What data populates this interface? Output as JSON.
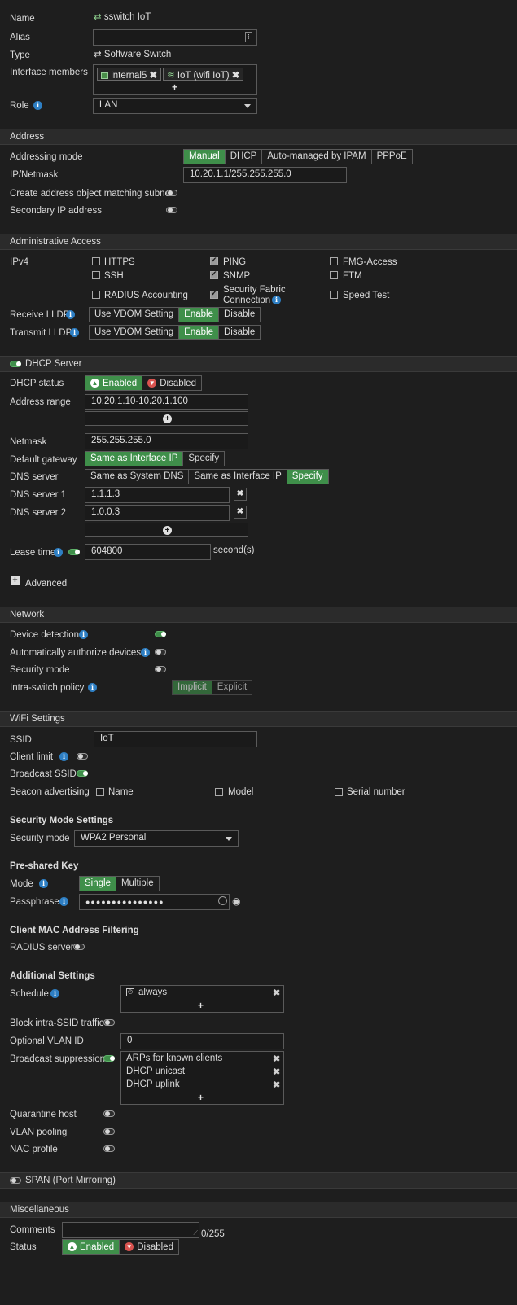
{
  "general": {
    "name_label": "Name",
    "name_value": "sswitch IoT",
    "alias_label": "Alias",
    "type_label": "Type",
    "type_value": "Software Switch",
    "members_label": "Interface members",
    "members": [
      "internal5",
      "IoT (wifi IoT)"
    ],
    "role_label": "Role",
    "role_value": "LAN"
  },
  "address": {
    "title": "Address",
    "mode_label": "Addressing mode",
    "modes": [
      "Manual",
      "DHCP",
      "Auto-managed by IPAM",
      "PPPoE"
    ],
    "ip_label": "IP/Netmask",
    "ip_value": "10.20.1.1/255.255.255.0",
    "create_obj_label": "Create address object matching subnet",
    "secondary_label": "Secondary IP address"
  },
  "admin": {
    "title": "Administrative Access",
    "ipv4_label": "IPv4",
    "opts": [
      "HTTPS",
      "PING",
      "FMG-Access",
      "SSH",
      "SNMP",
      "FTM",
      "RADIUS Accounting",
      "Security Fabric",
      "Connection",
      "Speed Test"
    ],
    "receive_label": "Receive LLDP",
    "transmit_label": "Transmit LLDP",
    "lldp": [
      "Use VDOM Setting",
      "Enable",
      "Disable"
    ]
  },
  "dhcp": {
    "title": "DHCP Server",
    "status_label": "DHCP status",
    "enabled": "Enabled",
    "disabled": "Disabled",
    "range_label": "Address range",
    "range_value": "10.20.1.10-10.20.1.100",
    "netmask_label": "Netmask",
    "netmask_value": "255.255.255.0",
    "gateway_label": "Default gateway",
    "gateway_opts": [
      "Same as Interface IP",
      "Specify"
    ],
    "dns_label": "DNS server",
    "dns_opts": [
      "Same as System DNS",
      "Same as Interface IP",
      "Specify"
    ],
    "dns1_label": "DNS server 1",
    "dns1_value": "1.1.1.3",
    "dns2_label": "DNS server 2",
    "dns2_value": "1.0.0.3",
    "lease_label": "Lease time",
    "lease_value": "604800",
    "lease_unit": "second(s)",
    "advanced": "Advanced"
  },
  "network": {
    "title": "Network",
    "device_detect": "Device detection",
    "auto_auth": "Automatically authorize devices",
    "sec_mode": "Security mode",
    "intra_label": "Intra-switch policy",
    "intra_opts": [
      "Implicit",
      "Explicit"
    ]
  },
  "wifi": {
    "title": "WiFi Settings",
    "ssid_label": "SSID",
    "ssid_value": "IoT",
    "client_limit": "Client limit",
    "broadcast_ssid": "Broadcast SSID",
    "beacon_label": "Beacon advertising",
    "beacon_opts": [
      "Name",
      "Model",
      "Serial number"
    ],
    "sec_settings": "Security Mode Settings",
    "sec_mode_label": "Security mode",
    "sec_mode_value": "WPA2 Personal",
    "psk_title": "Pre-shared Key",
    "mode_label": "Mode",
    "mode_opts": [
      "Single",
      "Multiple"
    ],
    "pass_label": "Passphrase",
    "pass_value": "●●●●●●●●●●●●●●●",
    "mac_title": "Client MAC Address Filtering",
    "radius_label": "RADIUS server",
    "add_title": "Additional Settings",
    "schedule_label": "Schedule",
    "schedule_value": "always",
    "block_intra": "Block intra-SSID traffic",
    "vlan_label": "Optional VLAN ID",
    "vlan_value": "0",
    "bcast_label": "Broadcast suppression",
    "bcast_items": [
      "ARPs for known clients",
      "DHCP unicast",
      "DHCP uplink"
    ],
    "quarantine": "Quarantine host",
    "vlan_pool": "VLAN pooling",
    "nac": "NAC profile"
  },
  "span": {
    "title": "SPAN (Port Mirroring)"
  },
  "misc": {
    "title": "Miscellaneous",
    "comments_label": "Comments",
    "counter": "0/255",
    "status_label": "Status",
    "enabled": "Enabled",
    "disabled": "Disabled"
  }
}
